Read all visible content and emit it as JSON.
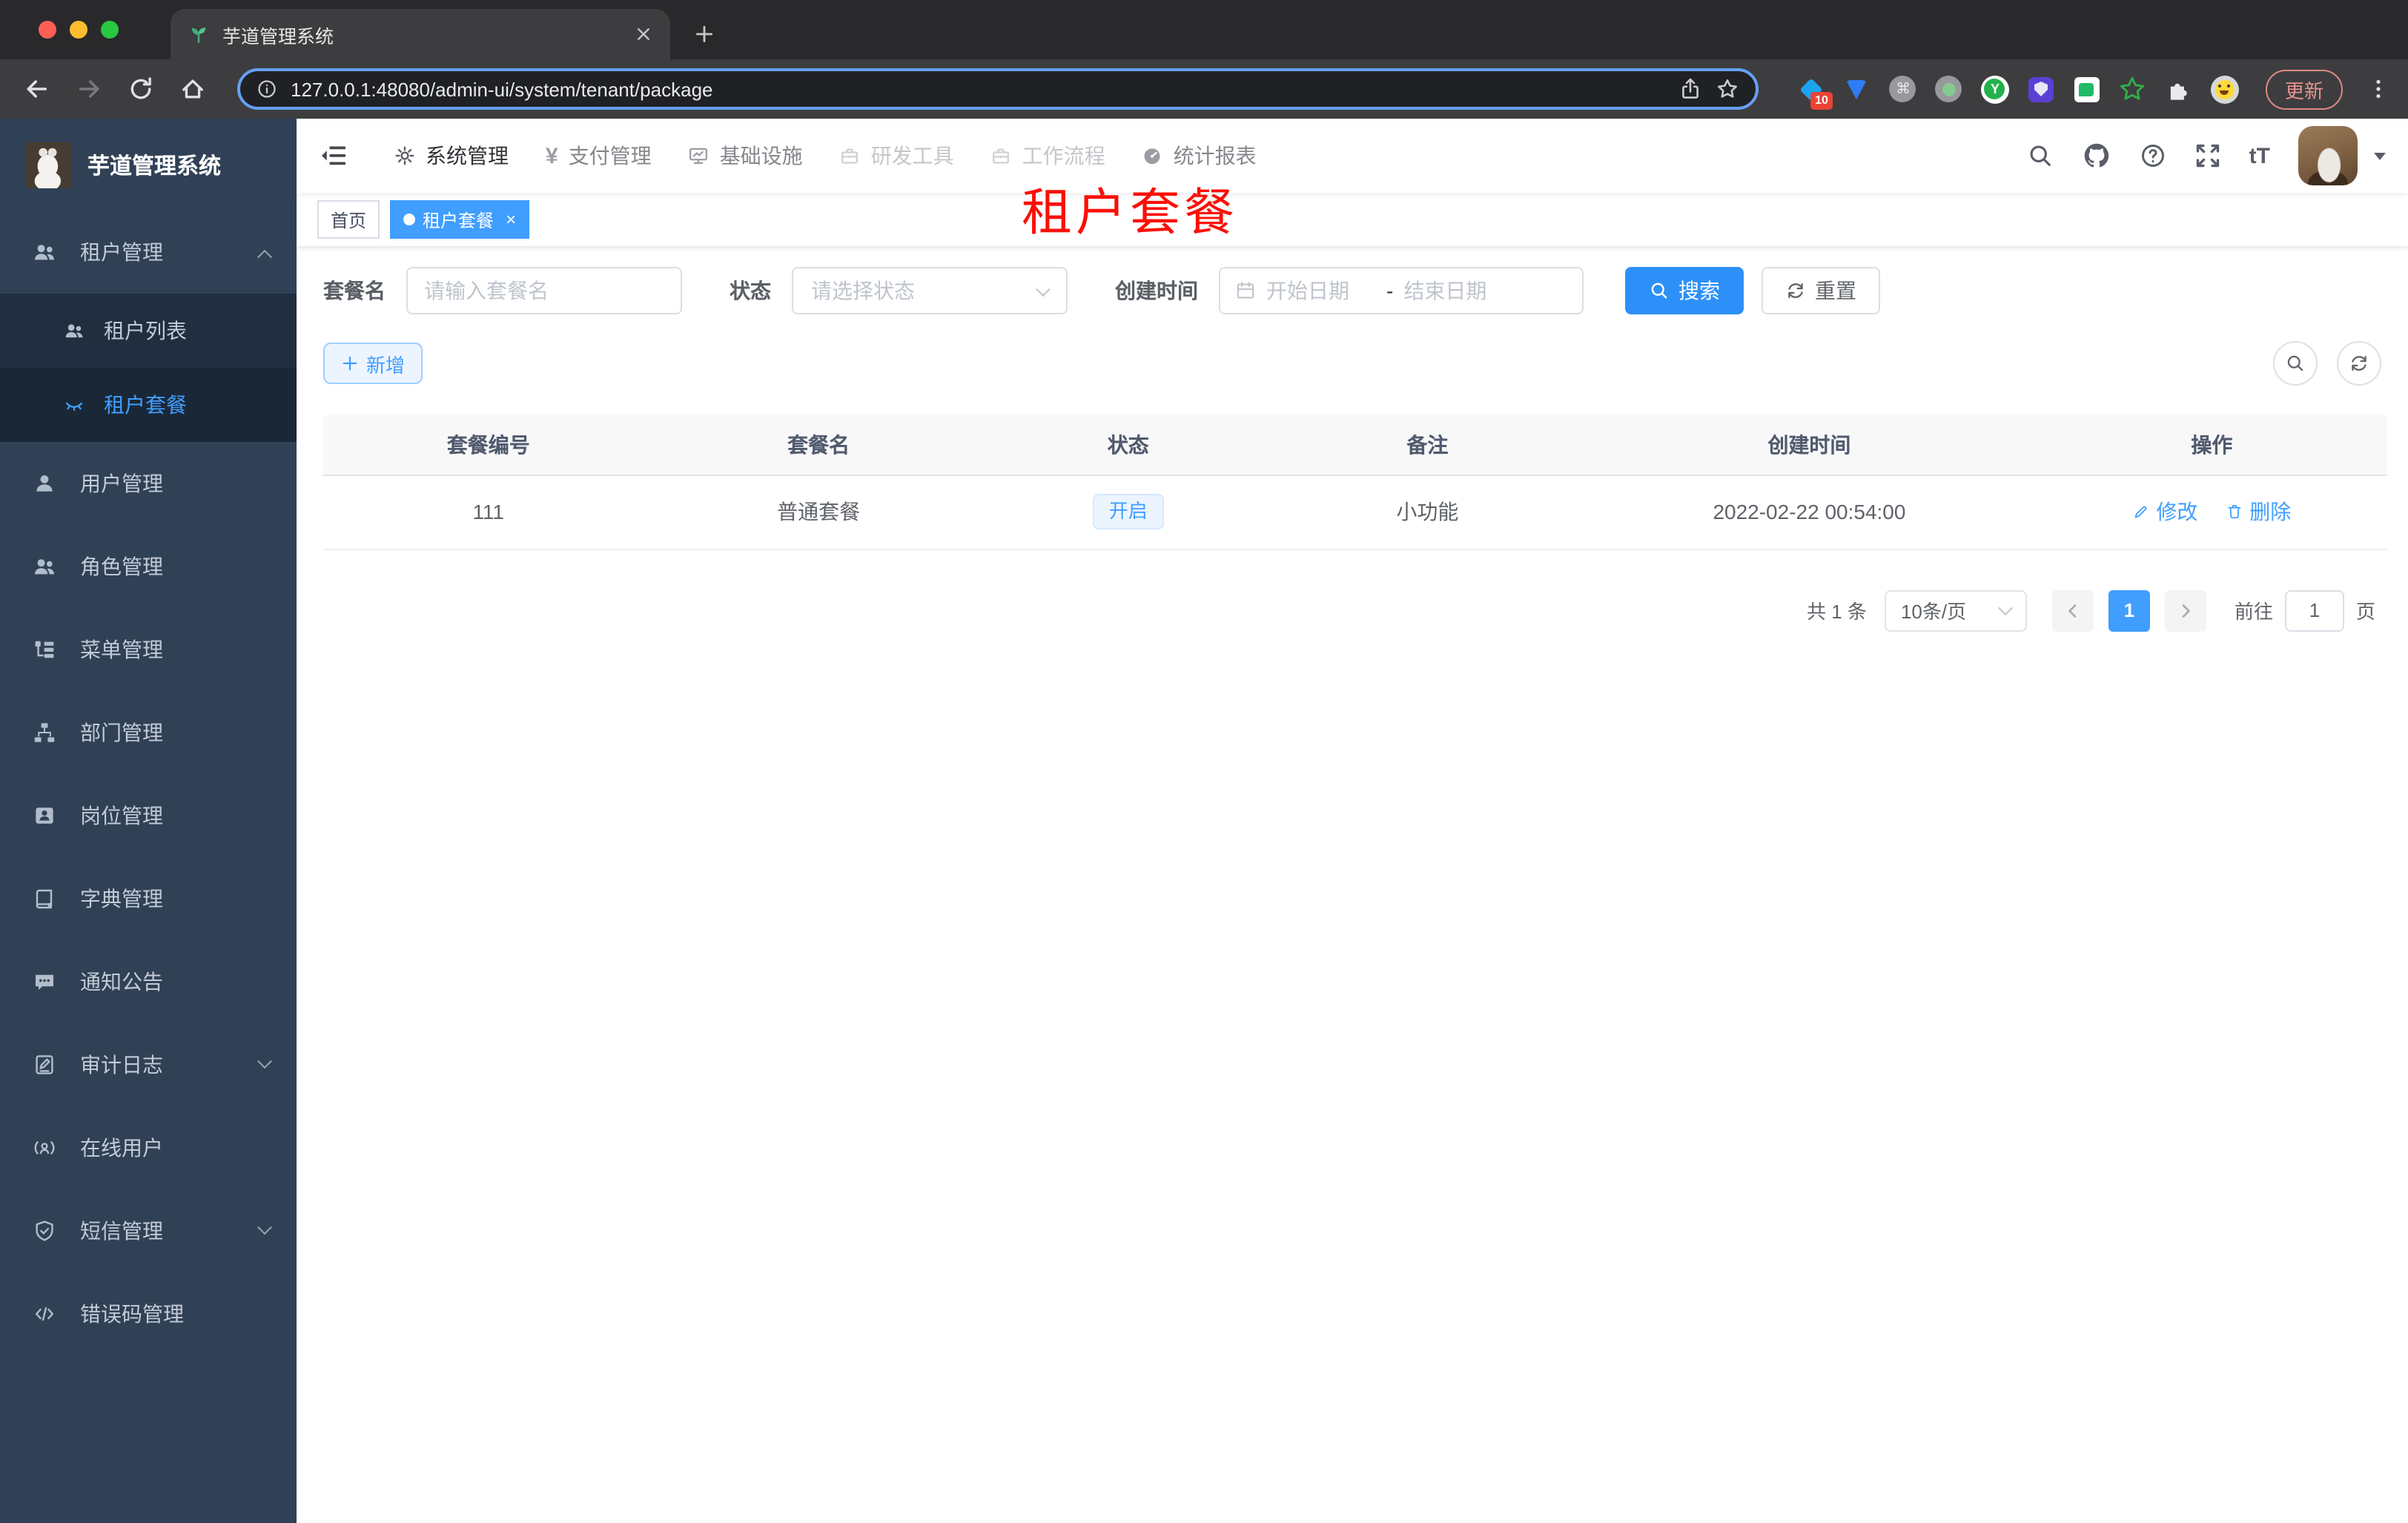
{
  "colors": {
    "accent": "#409eff",
    "sidebar_bg": "#304156",
    "submenu_bg": "#202e40",
    "chrome_bg": "#3d3d3f",
    "overlay_red": "#fb0f06"
  },
  "browser": {
    "tab_title": "芋道管理系统",
    "url": "127.0.0.1:48080/admin-ui/system/tenant/package",
    "ext_badge": "10",
    "update_label": "更新"
  },
  "sidebar": {
    "title": "芋道管理系统",
    "items": [
      {
        "label": "租户管理"
      },
      {
        "label": "租户列表"
      },
      {
        "label": "租户套餐"
      },
      {
        "label": "用户管理"
      },
      {
        "label": "角色管理"
      },
      {
        "label": "菜单管理"
      },
      {
        "label": "部门管理"
      },
      {
        "label": "岗位管理"
      },
      {
        "label": "字典管理"
      },
      {
        "label": "通知公告"
      },
      {
        "label": "审计日志"
      },
      {
        "label": "在线用户"
      },
      {
        "label": "短信管理"
      },
      {
        "label": "错误码管理"
      }
    ]
  },
  "topnav": {
    "items": [
      {
        "label": "系统管理"
      },
      {
        "label": "支付管理"
      },
      {
        "label": "基础设施"
      },
      {
        "label": "研发工具"
      },
      {
        "label": "工作流程"
      },
      {
        "label": "统计报表"
      }
    ],
    "yen_glyph": "¥",
    "fontsize_glyph": "tT"
  },
  "tags": {
    "home": "首页",
    "active": "租户套餐"
  },
  "overlay_label": "租户套餐",
  "filter": {
    "name_label": "套餐名",
    "name_placeholder": "请输入套餐名",
    "status_label": "状态",
    "status_placeholder": "请选择状态",
    "date_label": "创建时间",
    "date_start_placeholder": "开始日期",
    "date_separator": "-",
    "date_end_placeholder": "结束日期",
    "search_label": "搜索",
    "reset_label": "重置"
  },
  "actions": {
    "add_label": "新增"
  },
  "table": {
    "headers": [
      "套餐编号",
      "套餐名",
      "状态",
      "备注",
      "创建时间",
      "操作"
    ],
    "row": {
      "id": "111",
      "name": "普通套餐",
      "status": "开启",
      "remark": "小功能",
      "created_at": "2022-02-22 00:54:00",
      "edit_label": "修改",
      "delete_label": "删除"
    }
  },
  "pagination": {
    "total": "共 1 条",
    "page_size": "10条/页",
    "current_page": "1",
    "goto_label": "前往",
    "goto_value": "1",
    "page_unit": "页"
  }
}
